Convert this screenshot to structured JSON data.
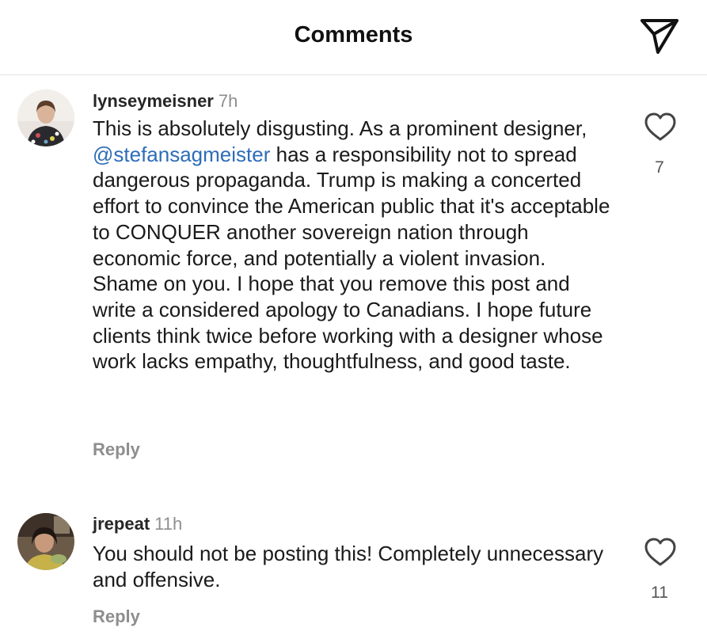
{
  "header": {
    "title": "Comments"
  },
  "comments": [
    {
      "username": "lynseymeisner",
      "time": "7h",
      "text_before": "This is absolutely disgusting. As a prominent designer, ",
      "mention": "@stefansagmeister",
      "text_after": " has a responsibility not to spread dangerous propaganda. Trump is making a concerted effort to convince the American public that it's acceptable to CONQUER another sovereign nation through economic force, and potentially a violent invasion. Shame on you. I hope that you remove this post and write a considered apology to Canadians. I hope future clients think twice before working with a designer whose work lacks empathy, thoughtfulness, and good taste.",
      "reply_label": "Reply",
      "likes": "7"
    },
    {
      "username": "jrepeat",
      "time": "11h",
      "text": "You should not be posting this! Completely unnecessary and offensive.",
      "reply_label": "Reply",
      "likes": "11"
    }
  ],
  "icons": {
    "send": "send-icon",
    "like": "heart-icon"
  },
  "colors": {
    "mention": "#2d6db8",
    "muted": "#8e8e8e"
  }
}
